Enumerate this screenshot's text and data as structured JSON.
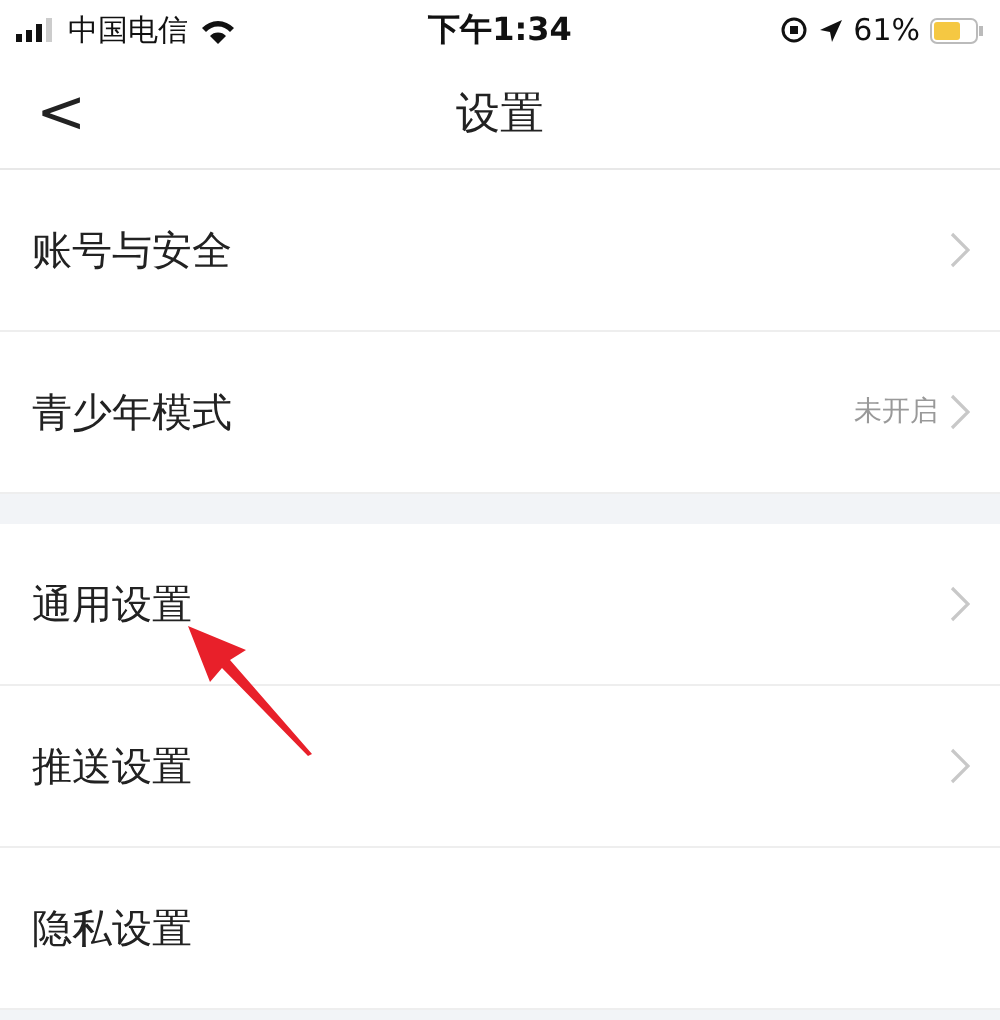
{
  "status_bar": {
    "carrier": "中国电信",
    "time": "下午1:34",
    "battery": "61%"
  },
  "nav": {
    "back": "<",
    "title": "设置"
  },
  "sections": [
    {
      "rows": [
        {
          "label": "账号与安全",
          "chevron": true
        },
        {
          "label": "青少年模式",
          "value": "未开启",
          "chevron": true
        }
      ]
    },
    {
      "rows": [
        {
          "label": "通用设置",
          "chevron": true,
          "pointed": true
        },
        {
          "label": "推送设置",
          "chevron": true
        },
        {
          "label": "隐私设置",
          "chevron": false
        }
      ]
    }
  ]
}
